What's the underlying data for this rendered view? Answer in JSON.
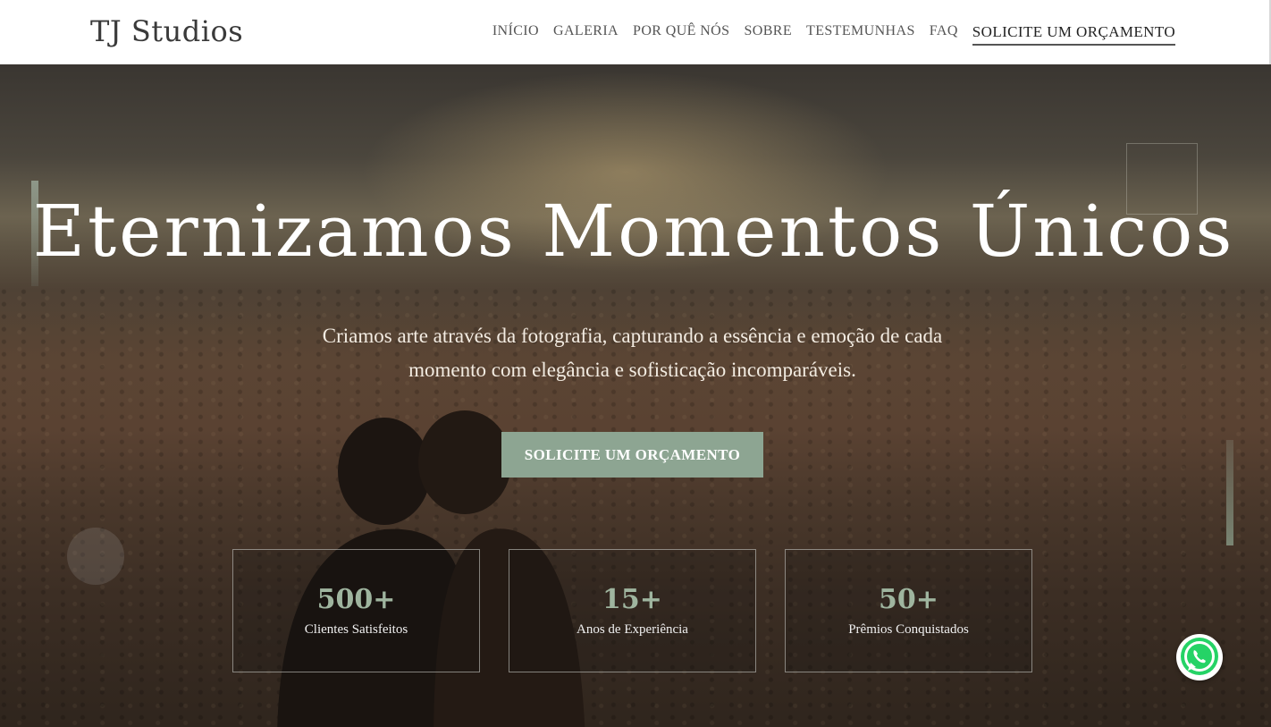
{
  "header": {
    "logo": "TJ Studios",
    "nav": [
      "INÍCIO",
      "GALERIA",
      "POR QUÊ NÓS",
      "SOBRE",
      "TESTEMUNHAS",
      "FAQ"
    ],
    "nav_cta": "SOLICITE UM ORÇAMENTO"
  },
  "hero": {
    "headline": "Eternizamos Momentos Únicos",
    "subtitle": "Criamos arte através da fotografia, capturando a essência e emoção de cada momento com elegância e sofisticação incomparáveis.",
    "cta_label": "SOLICITE UM ORÇAMENTO",
    "stats": [
      {
        "value": "500+",
        "label": "Clientes Satisfeitos"
      },
      {
        "value": "15+",
        "label": "Anos de Experiência"
      },
      {
        "value": "50+",
        "label": "Prêmios Conquistados"
      }
    ]
  },
  "colors": {
    "accent": "#8da592",
    "stat_number": "#9fb59f",
    "whatsapp": "#25d366"
  },
  "icons": {
    "floating_button": "whatsapp-icon"
  }
}
